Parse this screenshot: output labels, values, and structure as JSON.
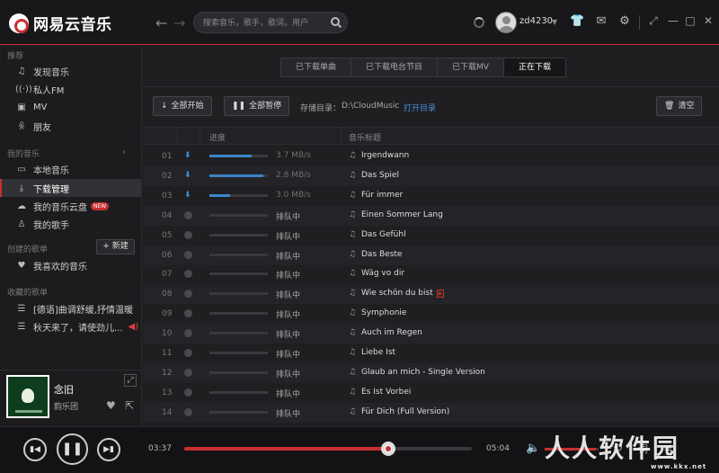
{
  "app": {
    "name": "网易云音乐"
  },
  "header": {
    "search_placeholder": "搜索音乐，歌手，歌词，用户",
    "username": "zd4230"
  },
  "sidebar": {
    "sections": [
      {
        "title": "推荐",
        "items": [
          {
            "icon": "music-note-icon",
            "label": "发现音乐"
          },
          {
            "icon": "radio-icon",
            "label": "私人FM"
          },
          {
            "icon": "mv-icon",
            "label": "MV"
          },
          {
            "icon": "friends-icon",
            "label": "朋友"
          }
        ]
      },
      {
        "title": "我的音乐",
        "items": [
          {
            "icon": "monitor-icon",
            "label": "本地音乐"
          },
          {
            "icon": "download-icon",
            "label": "下载管理"
          },
          {
            "icon": "cloud-icon",
            "label": "我的音乐云盘",
            "badge": "NEW"
          },
          {
            "icon": "person-icon",
            "label": "我的歌手"
          }
        ]
      },
      {
        "title": "创建的歌单",
        "items": [
          {
            "icon": "heart-icon",
            "label": "我喜欢的音乐"
          }
        ]
      },
      {
        "title": "收藏的歌单",
        "items": [
          {
            "icon": "playlist-icon",
            "label": "[德语]曲调舒缓,抒情温暖"
          },
          {
            "icon": "playlist-icon",
            "label": "秋天来了，请使劲儿..."
          }
        ]
      }
    ],
    "new_playlist_label": "新建",
    "active_item": "下载管理"
  },
  "now_playing": {
    "title": "念旧",
    "artist": "韵乐团"
  },
  "tabs": [
    {
      "label": "已下载单曲",
      "active": false
    },
    {
      "label": "已下载电台节目",
      "active": false
    },
    {
      "label": "已下载MV",
      "active": false
    },
    {
      "label": "正在下载",
      "active": true
    }
  ],
  "toolbar": {
    "start_all": "全部开始",
    "pause_all": "全部暂停",
    "storage_label": "存储目录：",
    "storage_path": "D:\\CloudMusic",
    "open_dir": "打开目录",
    "clear": "清空"
  },
  "table": {
    "headers": {
      "progress": "进度",
      "title": "音乐标题"
    },
    "rows": [
      {
        "no": "01",
        "status": "downloading",
        "progress": 0.72,
        "speed": "3.7 MB/s",
        "title": "Irgendwann",
        "mv": false
      },
      {
        "no": "02",
        "status": "downloading",
        "progress": 0.93,
        "speed": "2.8 MB/s",
        "title": "Das Spiel",
        "mv": false
      },
      {
        "no": "03",
        "status": "downloading",
        "progress": 0.35,
        "speed": "3.0 MB/s",
        "title": "Für immer",
        "mv": false
      },
      {
        "no": "04",
        "status": "waiting",
        "progress": 0,
        "speed": "排队中",
        "title": "Einen Sommer Lang",
        "mv": false
      },
      {
        "no": "05",
        "status": "waiting",
        "progress": 0,
        "speed": "排队中",
        "title": "Das Gefühl",
        "mv": false
      },
      {
        "no": "06",
        "status": "waiting",
        "progress": 0,
        "speed": "排队中",
        "title": "Das Beste",
        "mv": false
      },
      {
        "no": "07",
        "status": "waiting",
        "progress": 0,
        "speed": "排队中",
        "title": "Wäg vo dir",
        "mv": false
      },
      {
        "no": "08",
        "status": "waiting",
        "progress": 0,
        "speed": "排队中",
        "title": "Wie schön du bist",
        "mv": true
      },
      {
        "no": "09",
        "status": "waiting",
        "progress": 0,
        "speed": "排队中",
        "title": "Symphonie",
        "mv": false
      },
      {
        "no": "10",
        "status": "waiting",
        "progress": 0,
        "speed": "排队中",
        "title": "Auch im Regen",
        "mv": false
      },
      {
        "no": "11",
        "status": "waiting",
        "progress": 0,
        "speed": "排队中",
        "title": "Liebe Ist",
        "mv": false
      },
      {
        "no": "12",
        "status": "waiting",
        "progress": 0,
        "speed": "排队中",
        "title": "Glaub an mich - Single Version",
        "mv": false
      },
      {
        "no": "13",
        "status": "waiting",
        "progress": 0,
        "speed": "排队中",
        "title": "Es Ist Vorbei",
        "mv": false
      },
      {
        "no": "14",
        "status": "waiting",
        "progress": 0,
        "speed": "排队中",
        "title": "Für Dich (Full Version)",
        "mv": false
      }
    ]
  },
  "player": {
    "current_time": "03:37",
    "total_time": "05:04",
    "progress": 0.71,
    "volume": 0.95
  },
  "watermark": {
    "text": "人人软件园",
    "url": "www.kkx.net"
  },
  "colors": {
    "accent": "#c62f2f",
    "download_blue": "#3b84c8",
    "link": "#4a8fd8"
  }
}
